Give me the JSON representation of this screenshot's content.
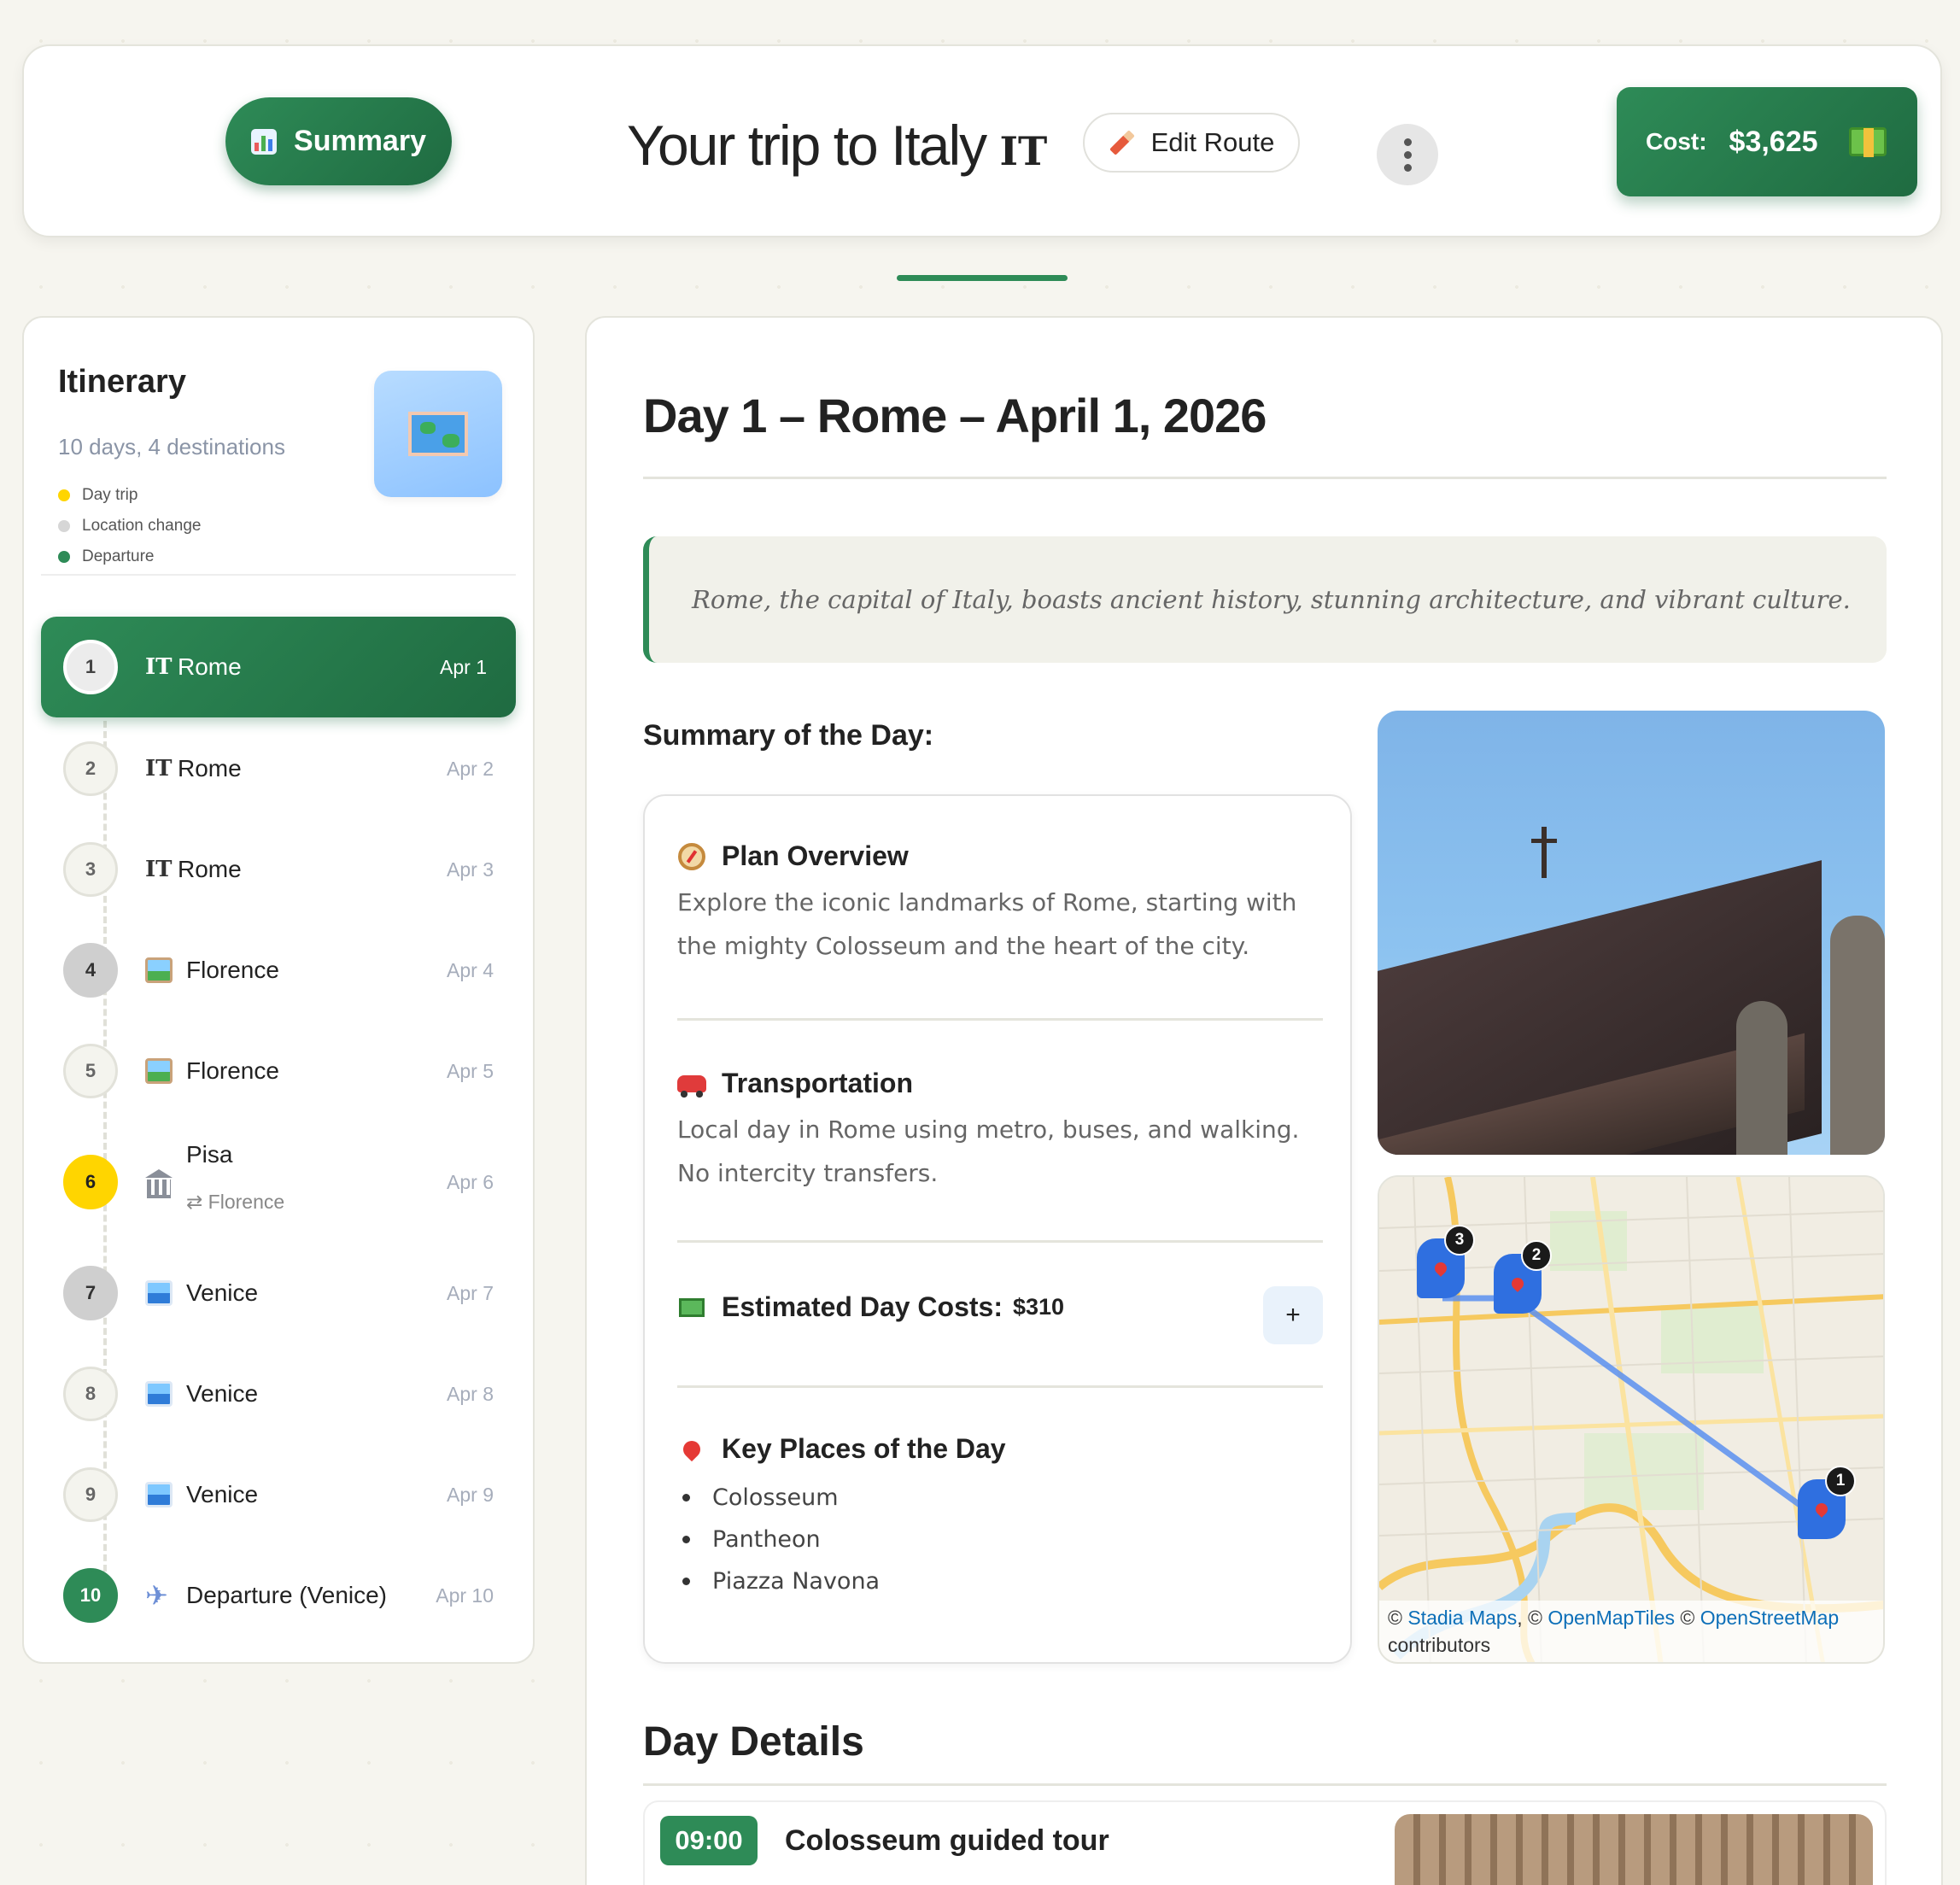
{
  "header": {
    "summary_label": "Summary",
    "title": "Your trip to Italy",
    "country_code": "IT",
    "edit_label": "Edit Route",
    "cost_label": "Cost:",
    "cost_value": "$3,625"
  },
  "sidebar": {
    "title": "Itinerary",
    "subtitle": "10 days, 4 destinations",
    "legend": [
      {
        "label": "Day trip",
        "color": "#ffd500"
      },
      {
        "label": "Location change",
        "color": "#d6d6d6"
      },
      {
        "label": "Departure",
        "color": "#2e8b57"
      }
    ],
    "days": [
      {
        "num": "1",
        "icon": "IT",
        "label": "Rome",
        "date": "Apr 1"
      },
      {
        "num": "2",
        "icon": "IT",
        "label": "Rome",
        "date": "Apr 2"
      },
      {
        "num": "3",
        "icon": "IT",
        "label": "Rome",
        "date": "Apr 3"
      },
      {
        "num": "4",
        "icon": "picture-icon",
        "label": "Florence",
        "date": "Apr 4"
      },
      {
        "num": "5",
        "icon": "picture-icon",
        "label": "Florence",
        "date": "Apr 5"
      },
      {
        "num": "6",
        "icon": "bank-icon",
        "label": "Pisa",
        "sub": "⇄ Florence",
        "date": "Apr 6"
      },
      {
        "num": "7",
        "icon": "venice-icon",
        "label": "Venice",
        "date": "Apr 7"
      },
      {
        "num": "8",
        "icon": "venice-icon",
        "label": "Venice",
        "date": "Apr 8"
      },
      {
        "num": "9",
        "icon": "venice-icon",
        "label": "Venice",
        "date": "Apr 9"
      },
      {
        "num": "10",
        "icon": "plane-icon",
        "label": "Departure (Venice)",
        "date": "Apr 10"
      }
    ]
  },
  "main": {
    "day_title": "Day 1 – Rome – April 1, 2026",
    "quote": "Rome, the capital of Italy, boasts ancient history, stunning architecture, and vibrant culture.",
    "summary_heading": "Summary of the Day:",
    "plan_heading": "Plan Overview",
    "plan_text": "Explore the iconic landmarks of Rome, starting with the mighty Colosseum and the heart of the city.",
    "transport_heading": "Transportation",
    "transport_text": "Local day in Rome using metro, buses, and walking. No intercity transfers.",
    "costs_heading": "Estimated Day Costs:",
    "costs_value": "$310",
    "plus_label": "+",
    "places_heading": "Key Places of the Day",
    "places": [
      "Colosseum",
      "Pantheon",
      "Piazza Navona"
    ],
    "map_markers": [
      "3",
      "2",
      "1"
    ],
    "map_attr_prefix": "© ",
    "map_attr_stadia": "Stadia Maps",
    "map_attr_mid": ", © ",
    "map_attr_omt": "OpenMapTiles",
    "map_attr_mid2": " © ",
    "map_attr_osm": "OpenStreetMap",
    "map_attr_suffix": "contributors",
    "details_heading": "Day Details",
    "event_time": "09:00",
    "event_title": "Colosseum guided tour"
  }
}
